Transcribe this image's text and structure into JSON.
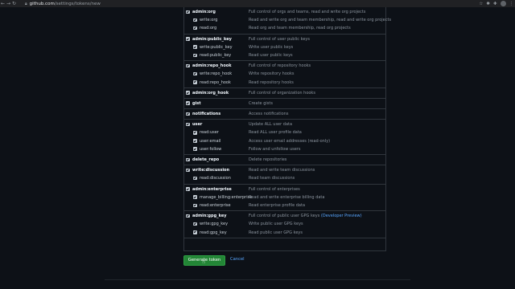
{
  "browser": {
    "url_host": "github.com",
    "url_path": "/settings/tokens/new",
    "back_icon": "arrow-left",
    "forward_icon": "arrow-right",
    "reload_icon": "reload"
  },
  "scopes": [
    {
      "name": "admin:org",
      "desc": "Full control of orgs and teams, read and write org projects",
      "children": [
        {
          "name": "write:org",
          "desc": "Read and write org and team membership, read and write org projects"
        },
        {
          "name": "read:org",
          "desc": "Read org and team membership, read org projects"
        }
      ]
    },
    {
      "name": "admin:public_key",
      "desc": "Full control of user public keys",
      "children": [
        {
          "name": "write:public_key",
          "desc": "Write user public keys"
        },
        {
          "name": "read:public_key",
          "desc": "Read user public keys"
        }
      ]
    },
    {
      "name": "admin:repo_hook",
      "desc": "Full control of repository hooks",
      "children": [
        {
          "name": "write:repo_hook",
          "desc": "Write repository hooks"
        },
        {
          "name": "read:repo_hook",
          "desc": "Read repository hooks"
        }
      ]
    },
    {
      "name": "admin:org_hook",
      "desc": "Full control of organization hooks",
      "children": []
    },
    {
      "name": "gist",
      "desc": "Create gists",
      "children": []
    },
    {
      "name": "notifications",
      "desc": "Access notifications",
      "children": []
    },
    {
      "name": "user",
      "desc": "Update ALL user data",
      "children": [
        {
          "name": "read:user",
          "desc": "Read ALL user profile data"
        },
        {
          "name": "user:email",
          "desc": "Access user email addresses (read-only)"
        },
        {
          "name": "user:follow",
          "desc": "Follow and unfollow users"
        }
      ]
    },
    {
      "name": "delete_repo",
      "desc": "Delete repositories",
      "children": []
    },
    {
      "name": "write:discussion",
      "desc": "Read and write team discussions",
      "children": [
        {
          "name": "read:discussion",
          "desc": "Read team discussions"
        }
      ]
    },
    {
      "name": "admin:enterprise",
      "desc": "Full control of enterprises",
      "children": [
        {
          "name": "manage_billing:enterprise",
          "desc": "Read and write enterprise billing data"
        },
        {
          "name": "read:enterprise",
          "desc": "Read enterprise profile data"
        }
      ]
    },
    {
      "name": "admin:gpg_key",
      "desc": "Full control of public user GPG keys",
      "link": "(Developer Preview)",
      "children": [
        {
          "name": "write:gpg_key",
          "desc": "Write public user GPG keys"
        },
        {
          "name": "read:gpg_key",
          "desc": "Read public user GPG keys"
        }
      ]
    }
  ],
  "actions": {
    "generate_label": "Generate token",
    "cancel_label": "Cancel"
  }
}
